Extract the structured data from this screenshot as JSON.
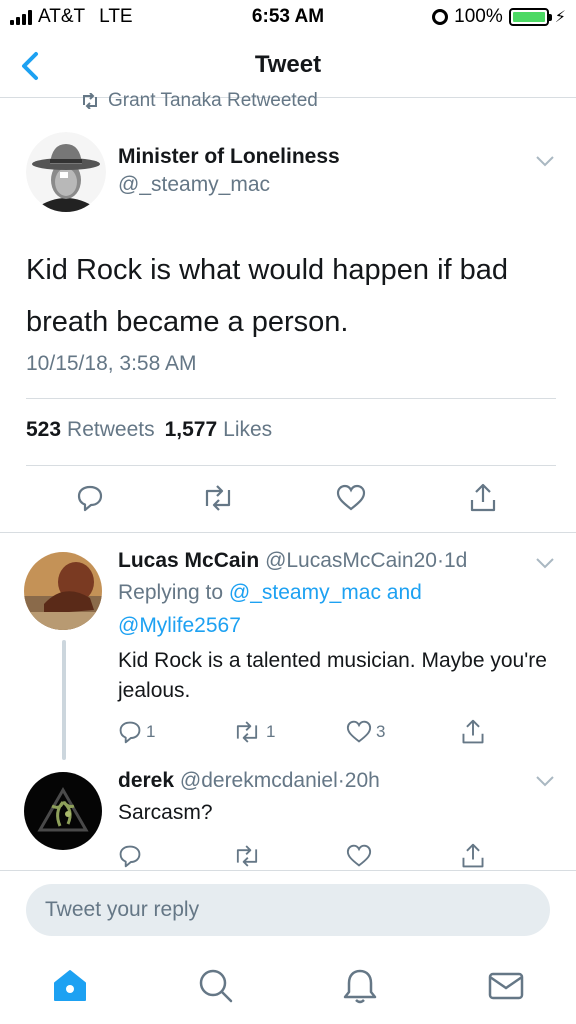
{
  "status_bar": {
    "carrier": "AT&T",
    "network": "LTE",
    "time": "6:53 AM",
    "battery": "100%",
    "battery_level": 1.0
  },
  "nav": {
    "title": "Tweet",
    "back_icon": "chevron-left-icon"
  },
  "retweet_banner": {
    "text": "Grant Tanaka Retweeted",
    "icon": "retweet-icon"
  },
  "main_tweet": {
    "author_name": "Minister of Loneliness",
    "author_handle": "@_steamy_mac",
    "text": "Kid Rock is what would happen if bad breath became a person.",
    "timestamp": "10/15/18, 3:58 AM",
    "retweets_count": "523",
    "retweets_label": "Retweets",
    "likes_count": "1,577",
    "likes_label": "Likes"
  },
  "replies": [
    {
      "name": "Lucas McCain",
      "handle": "@LucasMcCain20",
      "time": "1d",
      "replying_prefix": "Replying to",
      "replying_users": [
        "@_steamy_mac",
        "@Mylife2567"
      ],
      "replying_joiner": "and",
      "text": "Kid Rock is a talented musician. Maybe you're jealous.",
      "reply_count": "1",
      "retweet_count": "1",
      "like_count": "3"
    },
    {
      "name": "derek",
      "handle": "@derekmcdaniel",
      "time": "20h",
      "text": "Sarcasm?"
    }
  ],
  "compose": {
    "placeholder": "Tweet your reply"
  },
  "tab_bar": {
    "items": [
      "home-icon",
      "search-icon",
      "notifications-icon",
      "messages-icon"
    ]
  },
  "colors": {
    "accent": "#1da1f2",
    "secondary_text": "#657786",
    "divider": "#d8dde1",
    "battery": "#4cd964"
  }
}
